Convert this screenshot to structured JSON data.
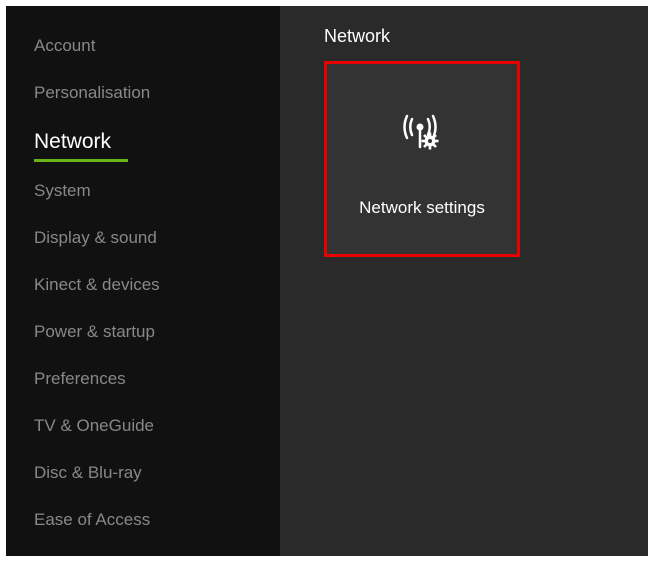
{
  "sidebar": {
    "items": [
      {
        "label": "Account",
        "active": false
      },
      {
        "label": "Personalisation",
        "active": false
      },
      {
        "label": "Network",
        "active": true
      },
      {
        "label": "System",
        "active": false
      },
      {
        "label": "Display & sound",
        "active": false
      },
      {
        "label": "Kinect & devices",
        "active": false
      },
      {
        "label": "Power & startup",
        "active": false
      },
      {
        "label": "Preferences",
        "active": false
      },
      {
        "label": "TV & OneGuide",
        "active": false
      },
      {
        "label": "Disc & Blu-ray",
        "active": false
      },
      {
        "label": "Ease of Access",
        "active": false
      }
    ]
  },
  "main": {
    "title": "Network",
    "tile": {
      "label": "Network settings"
    }
  }
}
